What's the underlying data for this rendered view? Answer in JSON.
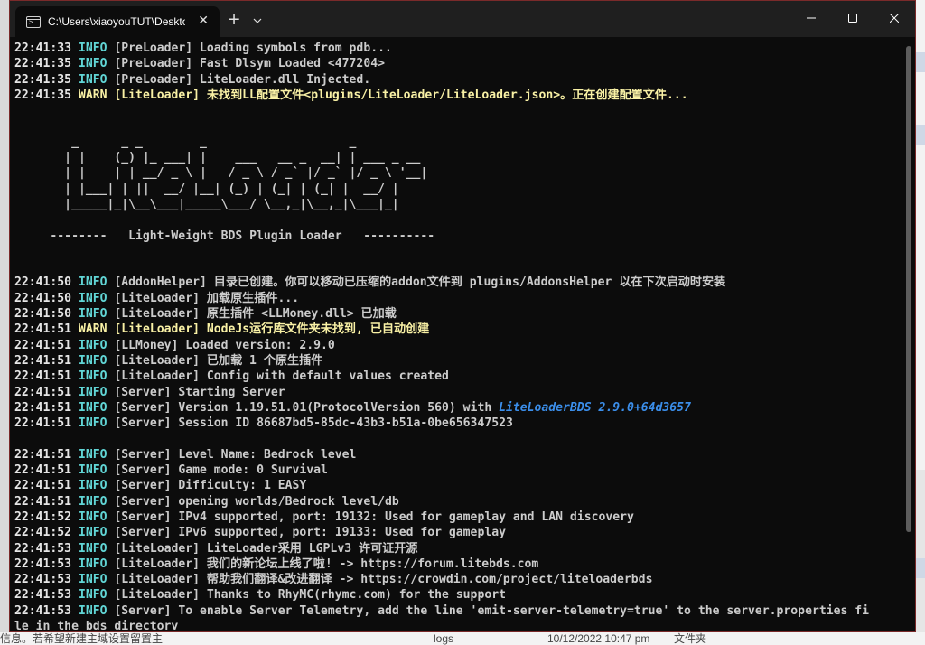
{
  "window": {
    "tab_title": "C:\\Users\\xiaoyouTUT\\Desktop",
    "tab_close": "✕",
    "new_tab": "+"
  },
  "background": {
    "bottom_left_text": "信息。若希望新建主域设置留置主",
    "bottom_item_name": "logs",
    "bottom_item_date": "10/12/2022 10:47 pm",
    "bottom_item_type": "文件夹"
  },
  "log_before": [
    {
      "time": "22:41:33",
      "level": "INFO",
      "text": "[PreLoader] Loading symbols from pdb..."
    },
    {
      "time": "22:41:35",
      "level": "INFO",
      "text": "[PreLoader] Fast Dlsym Loaded <477204>"
    },
    {
      "time": "22:41:35",
      "level": "INFO",
      "text": "[PreLoader] LiteLoader.dll Injected."
    },
    {
      "time": "22:41:35",
      "level": "WARN",
      "text": "[LiteLoader] 未找到LL配置文件<plugins/LiteLoader/LiteLoader.json>。正在创建配置文件..."
    }
  ],
  "banner": [
    "        _      _ _        _                    _",
    "       | |    (_) |_ ___| |    ___   __ _  __| | ___ _ __",
    "       | |    | | __/ _ \\ |   / _ \\ / _` |/ _` |/ _ \\ '__|",
    "       | |___| | ||  __/ |__| (_) | (_| | (_| |  __/ |",
    "       |_____|_|\\__\\___|_____\\___/ \\__,_|\\__,_|\\___|_|",
    "",
    "     --------   Light-Weight BDS Plugin Loader   ----------"
  ],
  "log_after": [
    {
      "time": "22:41:50",
      "level": "INFO",
      "text": "[AddonHelper] 目录已创建。你可以移动已压缩的addon文件到 plugins/AddonsHelper 以在下次启动时安装"
    },
    {
      "time": "22:41:50",
      "level": "INFO",
      "text": "[LiteLoader] 加载原生插件..."
    },
    {
      "time": "22:41:50",
      "level": "INFO",
      "text": "[LiteLoader] 原生插件 <LLMoney.dll> 已加载"
    },
    {
      "time": "22:41:51",
      "level": "WARN",
      "text": "[LiteLoader] NodeJs运行库文件夹未找到, 已自动创建"
    },
    {
      "time": "22:41:51",
      "level": "INFO",
      "text": "[LLMoney] Loaded version: 2.9.0"
    },
    {
      "time": "22:41:51",
      "level": "INFO",
      "text": "[LiteLoader] 已加载 1 个原生插件"
    },
    {
      "time": "22:41:51",
      "level": "INFO",
      "text": "[LiteLoader] Config with default values created"
    },
    {
      "time": "22:41:51",
      "level": "INFO",
      "text": "[Server] Starting Server"
    },
    {
      "time": "22:41:51",
      "level": "INFO",
      "text": "[Server] Version 1.19.51.01(ProtocolVersion 560) with ",
      "link": "LiteLoaderBDS 2.9.0+64d3657"
    },
    {
      "time": "22:41:51",
      "level": "INFO",
      "text": "[Server] Session ID 86687bd5-85dc-43b3-b51a-0be656347523"
    },
    {
      "time": "",
      "level": "",
      "text": ""
    },
    {
      "time": "22:41:51",
      "level": "INFO",
      "text": "[Server] Level Name: Bedrock level"
    },
    {
      "time": "22:41:51",
      "level": "INFO",
      "text": "[Server] Game mode: 0 Survival"
    },
    {
      "time": "22:41:51",
      "level": "INFO",
      "text": "[Server] Difficulty: 1 EASY"
    },
    {
      "time": "22:41:51",
      "level": "INFO",
      "text": "[Server] opening worlds/Bedrock level/db"
    },
    {
      "time": "22:41:52",
      "level": "INFO",
      "text": "[Server] IPv4 supported, port: 19132: Used for gameplay and LAN discovery"
    },
    {
      "time": "22:41:52",
      "level": "INFO",
      "text": "[Server] IPv6 supported, port: 19133: Used for gameplay"
    },
    {
      "time": "22:41:53",
      "level": "INFO",
      "text": "[LiteLoader] LiteLoader采用 LGPLv3 许可证开源"
    },
    {
      "time": "22:41:53",
      "level": "INFO",
      "text": "[LiteLoader] 我们的新论坛上线了啦! -> https://forum.litebds.com"
    },
    {
      "time": "22:41:53",
      "level": "INFO",
      "text": "[LiteLoader] 帮助我们翻译&改进翻译 -> https://crowdin.com/project/liteloaderbds"
    },
    {
      "time": "22:41:53",
      "level": "INFO",
      "text": "[LiteLoader] Thanks to RhyMC(rhymc.com) for the support"
    },
    {
      "time": "22:41:53",
      "level": "INFO",
      "text": "[Server] To enable Server Telemetry, add the line 'emit-server-telemetry=true' to the server.properties fi"
    },
    {
      "time": "",
      "level": "",
      "text": "le in the bds directory"
    }
  ],
  "icons": {
    "tab": "terminal-icon",
    "minimize": "minimize-icon",
    "maximize": "maximize-icon",
    "close": "close-icon",
    "dropdown": "chevron-down-icon"
  },
  "colors": {
    "info": "#61d6d6",
    "warn": "#f9f1a5",
    "link": "#3b8eea",
    "background": "#0c0c0c"
  }
}
